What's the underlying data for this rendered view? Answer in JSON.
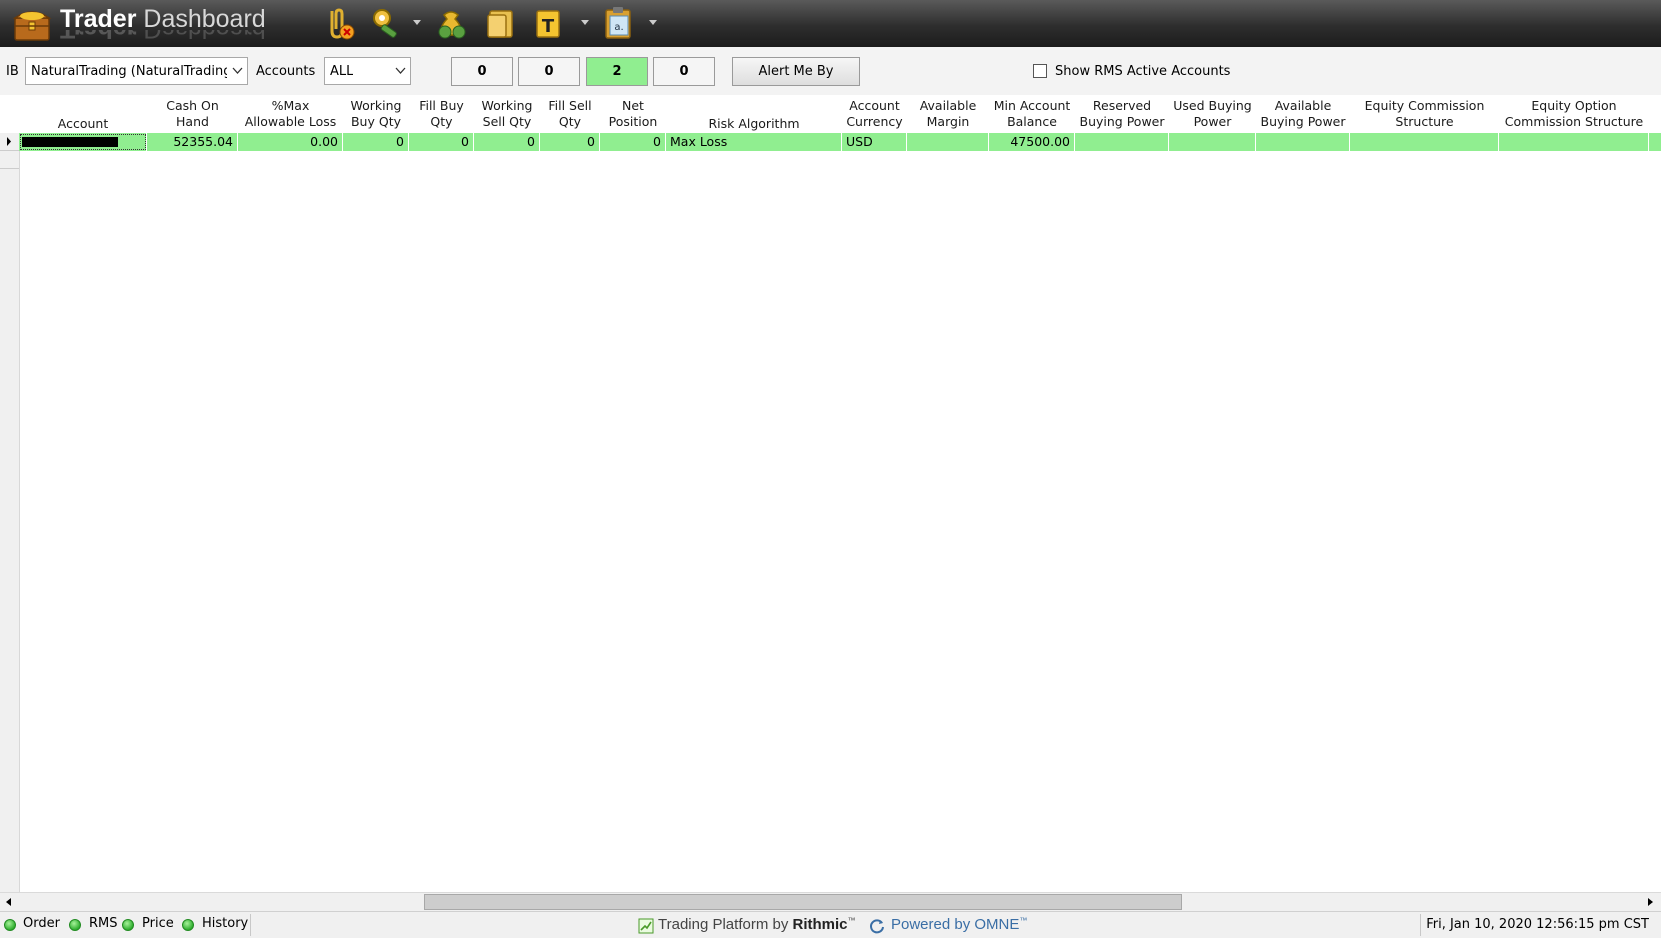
{
  "app": {
    "title_bold": "Trader",
    "title_light": "Dashboard"
  },
  "toolbar": {
    "icons": [
      "paperclip-cancel-icon",
      "tools-icon",
      "money-bag-icon",
      "folder-icon",
      "text-t-icon",
      "clipboard-icon"
    ]
  },
  "filters": {
    "ib_label": "IB",
    "ib_value": "NaturalTrading (NaturalTrading",
    "accounts_label": "Accounts",
    "accounts_value": "ALL",
    "counters": [
      "0",
      "0",
      "2",
      "0"
    ],
    "alert_button": "Alert Me By",
    "show_rms_label": "Show RMS Active Accounts",
    "show_rms_checked": false
  },
  "grid": {
    "columns": [
      {
        "line1": "",
        "line2": "Account"
      },
      {
        "line1": "Cash On",
        "line2": "Hand"
      },
      {
        "line1": "%Max",
        "line2": "Allowable Loss"
      },
      {
        "line1": "Working",
        "line2": "Buy Qty"
      },
      {
        "line1": "Fill Buy",
        "line2": "Qty"
      },
      {
        "line1": "Working",
        "line2": "Sell Qty"
      },
      {
        "line1": "Fill Sell",
        "line2": "Qty"
      },
      {
        "line1": "Net",
        "line2": "Position"
      },
      {
        "line1": "",
        "line2": "Risk Algorithm"
      },
      {
        "line1": "Account",
        "line2": "Currency"
      },
      {
        "line1": "Available",
        "line2": "Margin"
      },
      {
        "line1": "Min Account",
        "line2": "Balance"
      },
      {
        "line1": "Reserved",
        "line2": "Buying Power"
      },
      {
        "line1": "Used Buying",
        "line2": "Power"
      },
      {
        "line1": "Available",
        "line2": "Buying Power"
      },
      {
        "line1": "Equity Commission",
        "line2": "Structure"
      },
      {
        "line1": "Equity Option",
        "line2": "Commission Structure"
      }
    ],
    "rows": [
      {
        "cash_on_hand": "52355.04",
        "max_allowable_loss": "0.00",
        "working_buy_qty": "0",
        "fill_buy_qty": "0",
        "working_sell_qty": "0",
        "fill_sell_qty": "0",
        "net_position": "0",
        "risk_algorithm": "Max Loss",
        "account_currency": "USD",
        "available_margin": "",
        "min_account_balance": "47500.00",
        "reserved_buying_power": "",
        "used_buying_power": "",
        "available_buying_power": "",
        "equity_commission_structure": "",
        "equity_option_commission_structure": ""
      }
    ]
  },
  "status": {
    "order": "Order",
    "rms": "RMS",
    "price": "Price",
    "history": "History",
    "platform_text": "Trading Platform by",
    "platform_brand": "Rithmic",
    "tm": "™",
    "powered_text": "Powered by OMNE",
    "timestamp": "Fri, Jan 10, 2020 12:56:15 pm CST"
  },
  "colors": {
    "row_highlight": "#90ee90",
    "titlebar": "#2e2e2e",
    "status_dot": "#2fae2f"
  }
}
